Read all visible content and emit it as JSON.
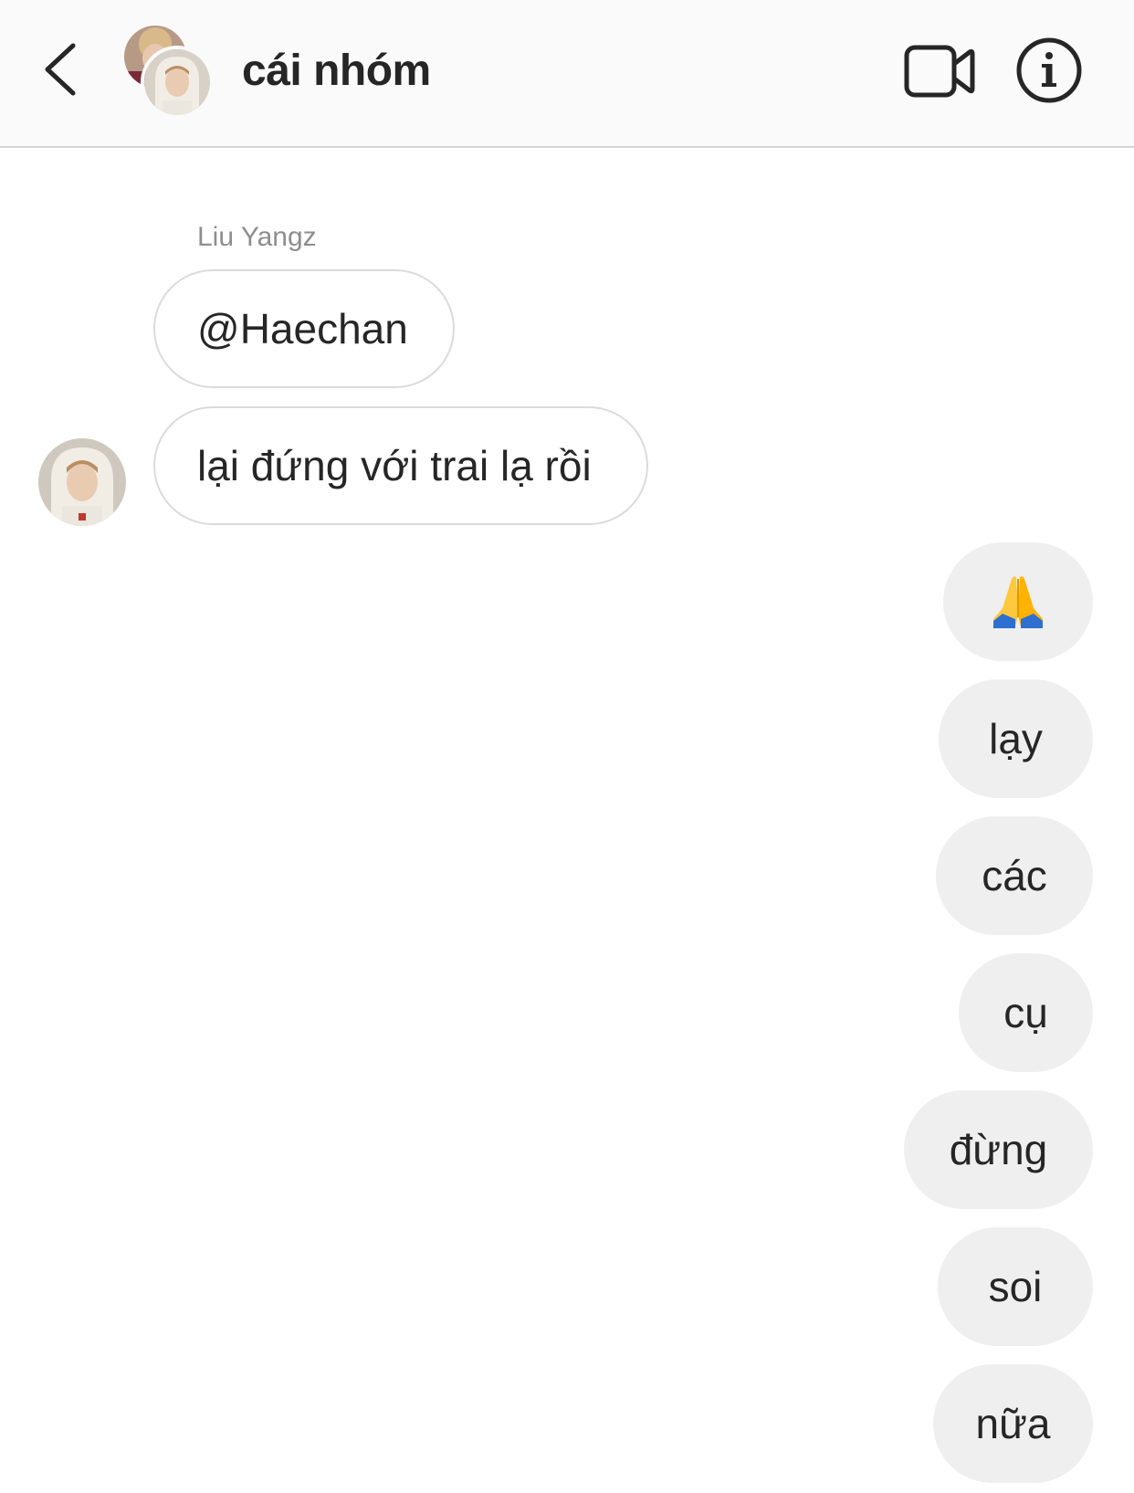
{
  "header": {
    "title": "cái nhóm",
    "back_icon": "chevron-left-icon",
    "video_icon": "video-camera-icon",
    "info_icon": "info-circle-icon"
  },
  "messages": {
    "incoming": {
      "sender": "Liu Yangz",
      "items": [
        {
          "text": "@Haechan"
        },
        {
          "text": "lại đứng với trai lạ rồi"
        }
      ]
    },
    "outgoing": [
      {
        "emoji": "folded-hands",
        "text": ""
      },
      {
        "text": "lạy"
      },
      {
        "text": "các"
      },
      {
        "text": "cụ"
      },
      {
        "text": "đừng"
      },
      {
        "text": "soi"
      },
      {
        "text": "nữa"
      }
    ]
  },
  "colors": {
    "header_bg": "#fafafa",
    "incoming_border": "#dbdbdb",
    "outgoing_bg": "#efefef",
    "text": "#262626",
    "sender_name": "#8e8e8e"
  }
}
